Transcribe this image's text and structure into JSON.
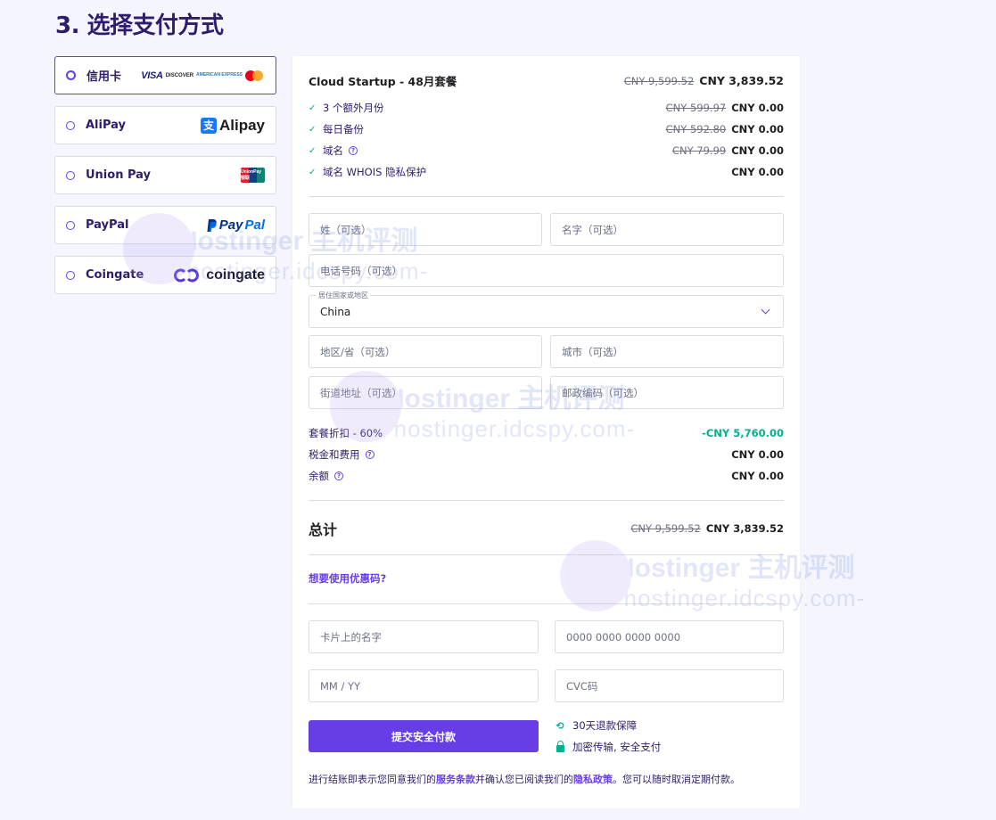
{
  "page_title": "3. 选择支付方式",
  "payment_methods": [
    {
      "label": "信用卡",
      "logos": [
        "VISA",
        "DISCOVER",
        "AMERICAN EXPRESS",
        "mastercard"
      ],
      "selected": true
    },
    {
      "label": "AliPay",
      "logo_text": "Alipay",
      "logo_icon": "支"
    },
    {
      "label": "Union Pay",
      "logo_text": "UnionPay 银联"
    },
    {
      "label": "PayPal",
      "logo_p1": "Pay",
      "logo_p2": "Pal"
    },
    {
      "label": "Coingate",
      "logo_text": "coingate"
    }
  ],
  "order": {
    "plan_name": "Cloud Startup - 48月套餐",
    "plan_old_price": "CNY 9,599.52",
    "plan_price": "CNY 3,839.52",
    "items": [
      {
        "label": "3 个额外月份",
        "old": "CNY 599.97",
        "price": "CNY 0.00"
      },
      {
        "label": "每日备份",
        "old": "CNY 592.80",
        "price": "CNY 0.00"
      },
      {
        "label": "域名",
        "old": "CNY 79.99",
        "price": "CNY 0.00",
        "help": true
      },
      {
        "label": "域名 WHOIS 隐私保护",
        "old": "",
        "price": "CNY 0.00"
      }
    ]
  },
  "form": {
    "last_name": "姓（可选）",
    "first_name": "名字（可选）",
    "phone": "电话号码（可选）",
    "country_label": "居住国家或地区",
    "country_value": "China",
    "region": "地区/省（可选）",
    "city": "城市（可选）",
    "street": "街道地址（可选）",
    "zip": "邮政编码（可选）"
  },
  "summary": {
    "discount_label": "套餐折扣 - 60%",
    "discount_value": "-CNY 5,760.00",
    "tax_label": "税金和费用",
    "tax_value": "CNY 0.00",
    "balance_label": "余额",
    "balance_value": "CNY 0.00",
    "total_label": "总计",
    "total_old": "CNY 9,599.52",
    "total_price": "CNY 3,839.52",
    "promo_link": "想要使用优惠码?"
  },
  "card": {
    "name_placeholder": "卡片上的名字",
    "number_placeholder": "0000 0000 0000 0000",
    "expiry_placeholder": "MM / YY",
    "cvc_placeholder": "CVC码"
  },
  "pay_button": "提交安全付款",
  "guarantees": {
    "refund": "30天退款保障",
    "secure": "加密传输, 安全支付"
  },
  "terms": {
    "pre": "进行结账即表示您同意我们的",
    "tos": "服务条款",
    "mid": "并确认您已阅读我们的",
    "privacy": "隐私政策",
    "post": "。您可以随时取消定期付款。"
  },
  "watermark": {
    "line1": "Hostinger 主机评测",
    "line2": "-hostinger.idcspy.com-"
  },
  "colors": {
    "accent": "#673de6",
    "success": "#00b090",
    "text": "#2f1c6a"
  }
}
